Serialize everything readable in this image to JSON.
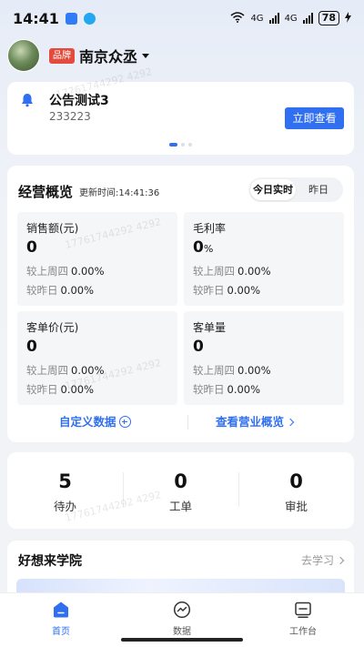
{
  "status_bar": {
    "time": "14:41",
    "network_1": "4G",
    "network_2": "4G",
    "battery": "78",
    "wifi_sup": "1"
  },
  "header": {
    "badge": "品牌",
    "store_name": "南京众丞"
  },
  "notice": {
    "title": "公告测试3",
    "subtitle": "233223",
    "button": "立即查看"
  },
  "overview": {
    "title": "经营概览",
    "update_time": "更新时间:14:41:36",
    "tabs": [
      "今日实时",
      "昨日"
    ],
    "metrics": [
      {
        "label": "销售额(元)",
        "value": "0",
        "unit": "",
        "cmp1_label": "较上周四",
        "cmp1_value": "0.00%",
        "cmp2_label": "较昨日",
        "cmp2_value": "0.00%"
      },
      {
        "label": "毛利率",
        "value": "0",
        "unit": "%",
        "cmp1_label": "较上周四",
        "cmp1_value": "0.00%",
        "cmp2_label": "较昨日",
        "cmp2_value": "0.00%"
      },
      {
        "label": "客单价(元)",
        "value": "0",
        "unit": "",
        "cmp1_label": "较上周四",
        "cmp1_value": "0.00%",
        "cmp2_label": "较昨日",
        "cmp2_value": "0.00%"
      },
      {
        "label": "客单量",
        "value": "0",
        "unit": "",
        "cmp1_label": "较上周四",
        "cmp1_value": "0.00%",
        "cmp2_label": "较昨日",
        "cmp2_value": "0.00%"
      }
    ],
    "custom_link": "自定义数据",
    "view_link": "查看营业概览"
  },
  "tasks": [
    {
      "count": "5",
      "label": "待办"
    },
    {
      "count": "0",
      "label": "工单"
    },
    {
      "count": "0",
      "label": "审批"
    }
  ],
  "academy": {
    "title": "好想来学院",
    "link": "去学习"
  },
  "tabbar": [
    {
      "label": "首页",
      "icon": "home-icon"
    },
    {
      "label": "数据",
      "icon": "data-icon"
    },
    {
      "label": "工作台",
      "icon": "workbench-icon"
    }
  ],
  "watermark": "17761744292 4292",
  "colors": {
    "accent": "#2f6ff0",
    "badge": "#e54b3c"
  }
}
